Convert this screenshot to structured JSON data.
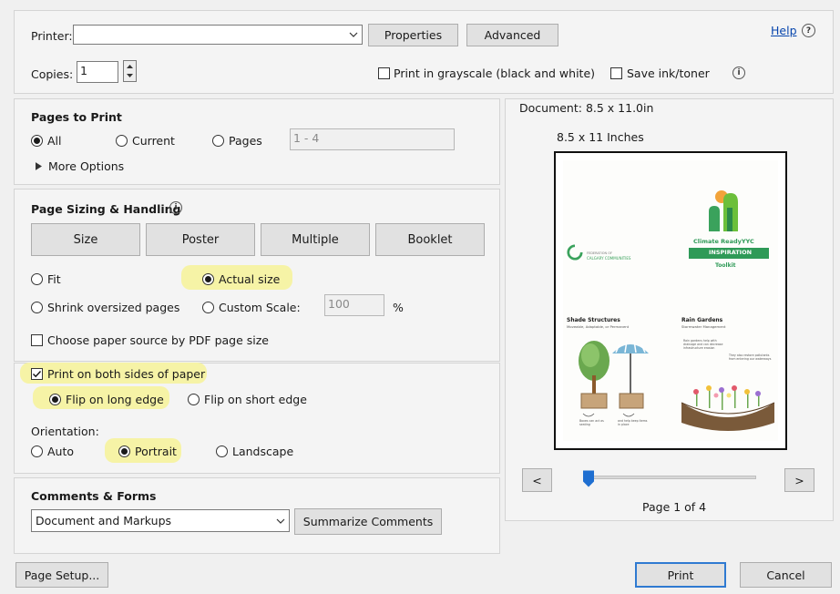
{
  "printer": {
    "label": "Printer:",
    "value": "",
    "properties": "Properties",
    "advanced": "Advanced",
    "help": "Help",
    "copies_label": "Copies:",
    "copies_value": "1",
    "grayscale": "Print in grayscale (black and white)",
    "save_ink": "Save ink/toner"
  },
  "pages": {
    "title": "Pages to Print",
    "all": "All",
    "current": "Current",
    "pages": "Pages",
    "range_placeholder": "1 - 4",
    "more": "More Options",
    "selected": "All"
  },
  "sizing": {
    "title": "Page Sizing & Handling",
    "tabs": [
      "Size",
      "Poster",
      "Multiple",
      "Booklet"
    ],
    "fit": "Fit",
    "actual": "Actual size",
    "shrink": "Shrink oversized pages",
    "custom": "Custom Scale:",
    "scale_value": "100",
    "percent": "%",
    "paper_source": "Choose paper source by PDF page size",
    "selected": "Actual size"
  },
  "duplex": {
    "both_sides": "Print on both sides of paper",
    "both_sides_checked": true,
    "long": "Flip on long edge",
    "short": "Flip on short edge",
    "orientation_label": "Orientation:",
    "auto": "Auto",
    "portrait": "Portrait",
    "landscape": "Landscape"
  },
  "comments": {
    "title": "Comments & Forms",
    "value": "Document and Markups",
    "summarize": "Summarize Comments"
  },
  "preview": {
    "document_size": "Document: 8.5 x 11.0in",
    "page_size": "8.5 x 11 Inches",
    "prev": "<",
    "next": ">",
    "page_status": "Page 1 of 4",
    "page_index": 1,
    "page_count": 4,
    "thumb": {
      "org": "CALGARY COMMUNITIES",
      "org_small": "FEDERATION OF",
      "brand": "Climate ReadyYYC",
      "banner": "INSPIRATION",
      "toolkit": "Toolkit",
      "shade_title": "Shade Structures",
      "shade_sub": "Moveable, Adaptable, or Permanent",
      "rain_title": "Rain Gardens",
      "rain_sub": "Stormwater Management",
      "note1": "Rain gardens help with drainage and can decrease infrastructure erosion",
      "note2": "They also restore pollutants from entering our waterways",
      "note3": "Boxes can act as seating",
      "note4": "and help keep items in place"
    }
  },
  "footer": {
    "page_setup": "Page Setup...",
    "print": "Print",
    "cancel": "Cancel"
  },
  "colors": {
    "highlight": "#f6f3a6",
    "accent_green": "#2e9a57",
    "slider_blue": "#1f6fd1"
  }
}
